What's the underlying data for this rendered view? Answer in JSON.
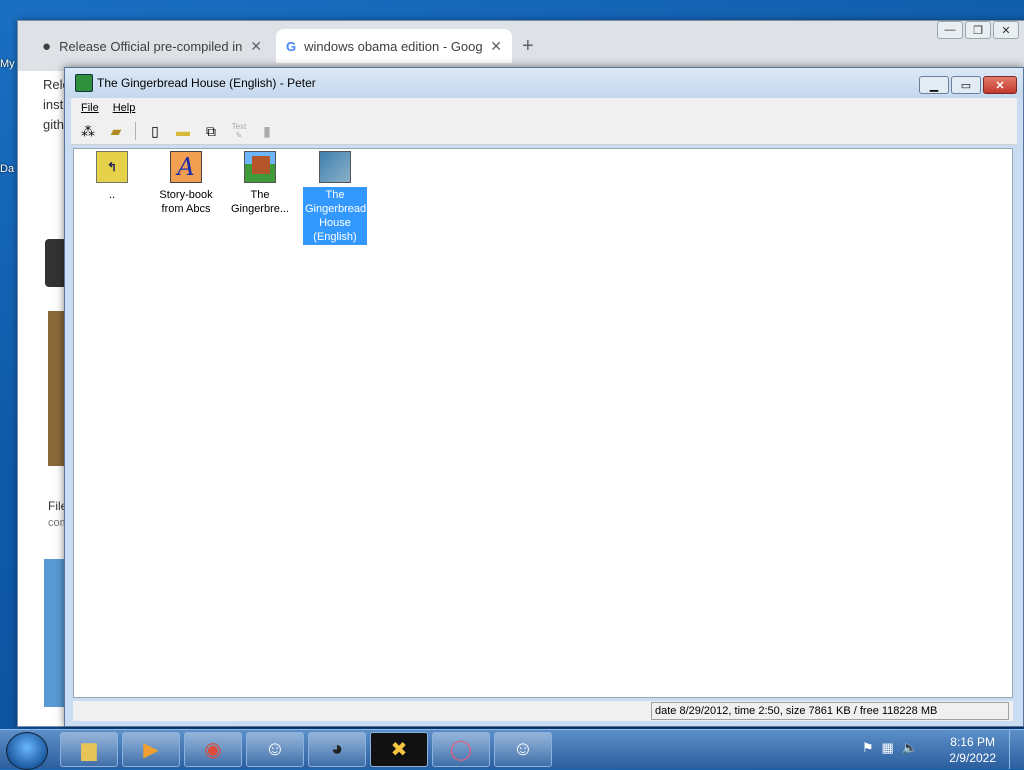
{
  "desktop": {
    "labels": [
      "My",
      "Da"
    ]
  },
  "chrome": {
    "tabs": [
      {
        "title": "Release Official pre-compiled ins",
        "icon": "github-icon"
      },
      {
        "title": "windows obama edition - Googl",
        "icon": "google-icon"
      }
    ],
    "new_tab": "+",
    "content_snippets": [
      "Rele",
      "inst",
      "gith",
      "File",
      "com"
    ]
  },
  "app": {
    "title": "The Gingerbread House (English) - Peter",
    "menu": [
      "File",
      "Help"
    ],
    "toolbar": [
      {
        "name": "tree-icon",
        "glyph": "⁂",
        "disabled": false
      },
      {
        "name": "open-folder-icon",
        "glyph": "📂",
        "disabled": false
      },
      {
        "name": "new-file-icon",
        "glyph": "🗋",
        "disabled": false
      },
      {
        "name": "folder-icon",
        "glyph": "📁",
        "disabled": false
      },
      {
        "name": "copy-icon",
        "glyph": "⧉",
        "disabled": false
      },
      {
        "name": "text-tool-icon",
        "glyph": "✎",
        "disabled": true,
        "caption": "Text"
      },
      {
        "name": "trash-icon",
        "glyph": "🗑",
        "disabled": true
      }
    ],
    "items": [
      {
        "label": "..",
        "icon": "up-folder-icon",
        "selected": false
      },
      {
        "label": "Story-book from Abcs",
        "icon": "storybook-icon",
        "selected": false
      },
      {
        "label": "The Gingerbre...",
        "icon": "house-icon",
        "selected": false
      },
      {
        "label": "The Gingerbread House (English)",
        "icon": "house-english-icon",
        "selected": true
      }
    ],
    "status": "date 8/29/2012, time 2:50, size 7861 KB / free 118228 MB"
  },
  "taskbar": {
    "apps": [
      {
        "name": "file-explorer-icon",
        "glyph": "🗂"
      },
      {
        "name": "media-player-icon",
        "glyph": "▶"
      },
      {
        "name": "chrome-icon",
        "glyph": "◉"
      },
      {
        "name": "bunny-app-icon",
        "glyph": "🐰"
      },
      {
        "name": "alien-app-icon",
        "glyph": "👽"
      },
      {
        "name": "x-app-icon",
        "glyph": "✖"
      },
      {
        "name": "ring-app-icon",
        "glyph": "◯"
      },
      {
        "name": "bunny-app-icon-2",
        "glyph": "🐰"
      }
    ],
    "time": "8:16 PM",
    "date": "2/9/2022"
  },
  "colors": {
    "selection": "#3399ff",
    "taskbar": "#2b5e9e"
  }
}
